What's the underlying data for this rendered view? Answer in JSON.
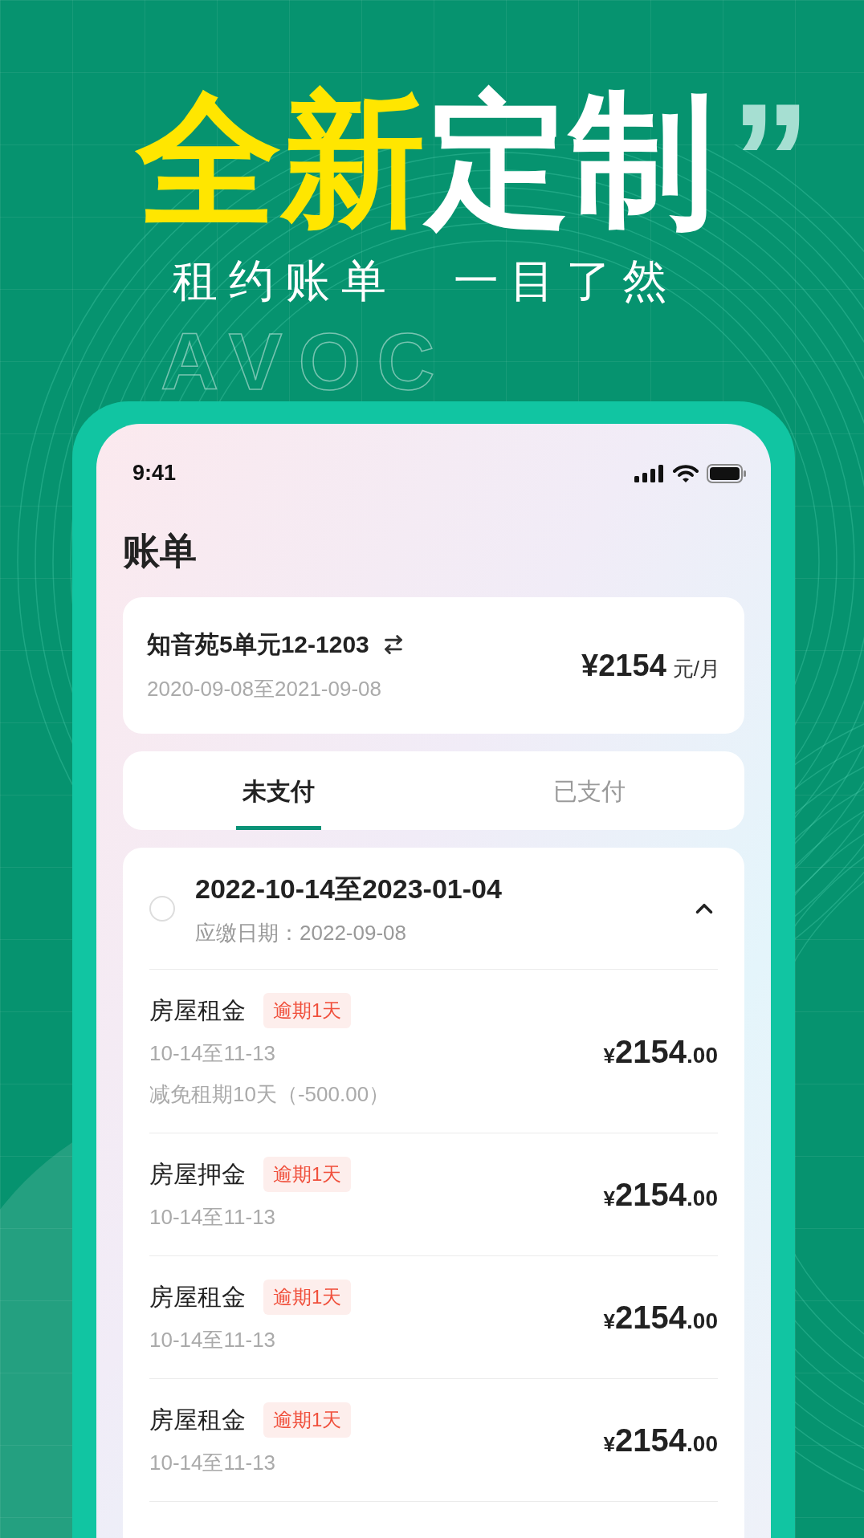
{
  "headline": {
    "highlight": "全新",
    "rest": "定制",
    "quote": "”"
  },
  "subtitle": [
    "租约账单",
    "一目了然"
  ],
  "background_text": "AVOC",
  "status_bar": {
    "time": "9:41"
  },
  "page_title": "账单",
  "lease": {
    "address": "知音苑5单元12-1203",
    "period": "2020-09-08至2021-09-08",
    "price": "¥2154",
    "unit": "元/月"
  },
  "tabs": [
    {
      "label": "未支付",
      "selected": true
    },
    {
      "label": "已支付",
      "selected": false
    }
  ],
  "bill": {
    "selected": false,
    "expanded": true,
    "period": "2022-10-14至2023-01-04",
    "due": "应缴日期：2022-09-08",
    "items": [
      {
        "name": "房屋租金",
        "badge": "逾期1天",
        "dates": "10-14至11-13",
        "note": "减免租期10天（-500.00）",
        "currency": "¥",
        "amount": "2154",
        "cents": ".00"
      },
      {
        "name": "房屋押金",
        "badge": "逾期1天",
        "dates": "10-14至11-13",
        "currency": "¥",
        "amount": "2154",
        "cents": ".00"
      },
      {
        "name": "房屋租金",
        "badge": "逾期1天",
        "dates": "10-14至11-13",
        "currency": "¥",
        "amount": "2154",
        "cents": ".00"
      },
      {
        "name": "房屋租金",
        "badge": "逾期1天",
        "dates": "10-14至11-13",
        "currency": "¥",
        "amount": "2154",
        "cents": ".00"
      }
    ]
  }
}
